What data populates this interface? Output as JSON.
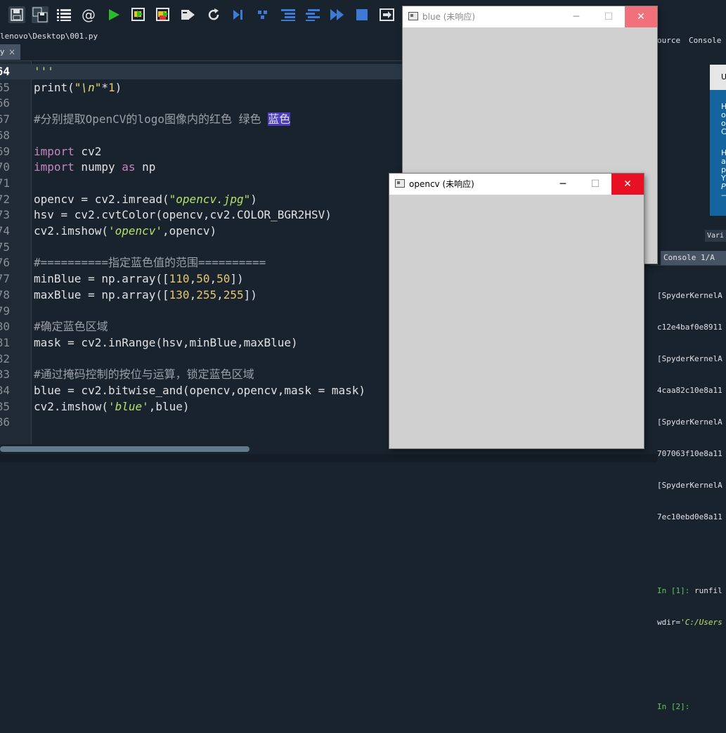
{
  "toolbar": {
    "icons": [
      "save-icon",
      "save-all-icon",
      "outline-icon",
      "at-icon",
      "run-icon",
      "run-cell-icon",
      "run-cell-advance-icon",
      "run-selection-icon",
      "rerun-icon",
      "debug-icon",
      "step-icon",
      "step-into-icon",
      "step-return-icon",
      "continue-icon",
      "stop-icon",
      "maximize-pane-icon"
    ],
    "at_glyph": "@"
  },
  "editor": {
    "file_path": "lenovo\\Desktop\\001.py",
    "tab_label": "y",
    "tab_close": "×",
    "lines": [
      {
        "num": "64",
        "html": "<span class=\"str\">'''</span>",
        "current": true
      },
      {
        "num": "65",
        "html": "print(<span class=\"str2\">\"\\n\"</span>*<span class=\"num\">1</span>)"
      },
      {
        "num": "66",
        "html": ""
      },
      {
        "num": "67",
        "html": "<span class=\"com\">#分别提取OpenCV的logo图像内的红色 绿色 </span><span class=\"hl\">蓝色</span>"
      },
      {
        "num": "68",
        "html": ""
      },
      {
        "num": "69",
        "html": "<span class=\"kw\">import</span> cv2"
      },
      {
        "num": "70",
        "html": "<span class=\"kw\">import</span> numpy <span class=\"kw\">as</span> np"
      },
      {
        "num": "71",
        "html": ""
      },
      {
        "num": "72",
        "html": "opencv = cv2.imread(<span class=\"str\">\"opencv.jpg\"</span>)"
      },
      {
        "num": "73",
        "html": "hsv = cv2.cvtColor(opencv,cv2.COLOR_BGR2HSV)"
      },
      {
        "num": "74",
        "html": "cv2.imshow(<span class=\"str\">'opencv'</span>,opencv)"
      },
      {
        "num": "75",
        "html": ""
      },
      {
        "num": "76",
        "html": "<span class=\"com\">#==========指定蓝色值的范围==========</span>"
      },
      {
        "num": "77",
        "html": "minBlue = np.array([<span class=\"num\">110</span>,<span class=\"num\">50</span>,<span class=\"num\">50</span>])"
      },
      {
        "num": "78",
        "html": "maxBlue = np.array([<span class=\"num\">130</span>,<span class=\"num\">255</span>,<span class=\"num\">255</span>])"
      },
      {
        "num": "79",
        "html": ""
      },
      {
        "num": "80",
        "html": "<span class=\"com\">#确定蓝色区域</span>"
      },
      {
        "num": "81",
        "html": "mask = cv2.inRange(hsv,minBlue,maxBlue)"
      },
      {
        "num": "82",
        "html": ""
      },
      {
        "num": "83",
        "html": "<span class=\"com\">#通过掩码控制的按位与运算，锁定蓝色区域</span>"
      },
      {
        "num": "84",
        "html": "blue = cv2.bitwise_and(opencv,opencv,mask = mask)"
      },
      {
        "num": "85",
        "html": "cv2.imshow(<span class=\"str\">'blue'</span>,blue)"
      },
      {
        "num": "86",
        "html": ""
      }
    ]
  },
  "right_pane": {
    "help_tab_source": "ource",
    "help_tab_console": "Console",
    "popup_title": "U",
    "popup_lines_1": [
      "H",
      "o",
      "o",
      "C"
    ],
    "popup_lines_2": [
      "H",
      "a",
      "p",
      "Y",
      "P"
    ],
    "popup_rule": "—",
    "var_tab": "Vari",
    "console_tab": "Console 1/A",
    "console_lines": [
      "[SpyderKernelA",
      "c12e4baf0e8911",
      "[SpyderKernelA",
      "4caa82c10e8a11",
      "[SpyderKernelA",
      "707063f10e8a11",
      "[SpyderKernelA",
      "7ec10ebd0e8a11"
    ],
    "prompt1": "In [1]:",
    "prompt1_cmd": " runfil",
    "wdir_prefix": "wdir=",
    "wdir_value": "'C:/Users",
    "prompt2": "In [2]:"
  },
  "windows": {
    "blue": {
      "title": "blue (未响应)",
      "min": "─",
      "max": "☐",
      "close": "✕"
    },
    "opencv": {
      "title": "opencv (未响应)",
      "min": "─",
      "max": "☐",
      "close": "✕"
    }
  },
  "colors": {
    "close_active": "#e81123",
    "close_inactive": "#f1707a",
    "window_body": "#d0d0d0"
  }
}
